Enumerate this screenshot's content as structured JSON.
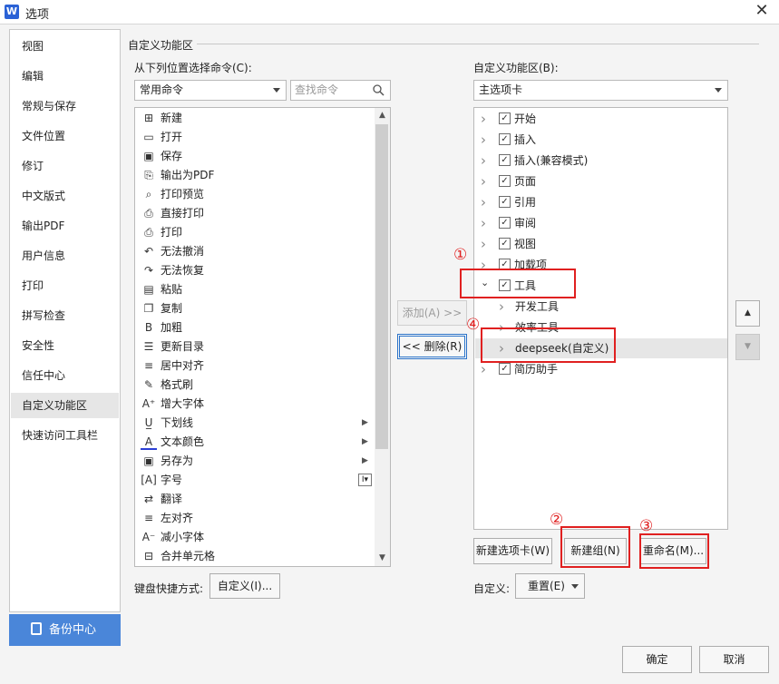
{
  "window": {
    "title": "选项",
    "app_badge": "W",
    "close_glyph": "✕"
  },
  "sidebar": {
    "items": [
      {
        "label": "视图"
      },
      {
        "label": "编辑"
      },
      {
        "label": "常规与保存"
      },
      {
        "label": "文件位置"
      },
      {
        "label": "修订"
      },
      {
        "label": "中文版式"
      },
      {
        "label": "输出PDF"
      },
      {
        "label": "用户信息"
      },
      {
        "label": "打印"
      },
      {
        "label": "拼写检查"
      },
      {
        "label": "安全性"
      },
      {
        "label": "信任中心"
      },
      {
        "label": "自定义功能区",
        "active": true
      },
      {
        "label": "快速访问工具栏"
      }
    ],
    "backup_label": "备份中心"
  },
  "main": {
    "section_title": "自定义功能区",
    "left": {
      "source_label": "从下列位置选择命令(C):",
      "source_value": "常用命令",
      "search_placeholder": "查找命令",
      "commands": [
        {
          "icon": "new-icon",
          "glyph": "⊞",
          "label": "新建"
        },
        {
          "icon": "open-icon",
          "glyph": "▭",
          "label": "打开"
        },
        {
          "icon": "save-icon",
          "glyph": "▣",
          "label": "保存"
        },
        {
          "icon": "export-pdf-icon",
          "glyph": "⎘",
          "label": "输出为PDF"
        },
        {
          "icon": "print-preview-icon",
          "glyph": "⌕",
          "label": "打印预览"
        },
        {
          "icon": "direct-print-icon",
          "glyph": "⎙",
          "label": "直接打印"
        },
        {
          "icon": "print-icon",
          "glyph": "⎙",
          "label": "打印"
        },
        {
          "icon": "undo-icon",
          "glyph": "↶",
          "label": "无法撤消"
        },
        {
          "icon": "redo-icon",
          "glyph": "↷",
          "label": "无法恢复"
        },
        {
          "icon": "paste-icon",
          "glyph": "▤",
          "label": "粘贴"
        },
        {
          "icon": "copy-icon",
          "glyph": "❐",
          "label": "复制"
        },
        {
          "icon": "bold-icon",
          "glyph": "B",
          "label": "加粗"
        },
        {
          "icon": "update-toc-icon",
          "glyph": "☰",
          "label": "更新目录"
        },
        {
          "icon": "align-center-icon",
          "glyph": "≡",
          "label": "居中对齐"
        },
        {
          "icon": "format-painter-icon",
          "glyph": "✎",
          "label": "格式刷"
        },
        {
          "icon": "grow-font-icon",
          "glyph": "A⁺",
          "label": "增大字体"
        },
        {
          "icon": "underline-icon",
          "glyph": "U̲",
          "label": "下划线",
          "sub": "▶"
        },
        {
          "icon": "font-color-icon",
          "glyph": "A",
          "label": "文本颜色",
          "sub": "▶"
        },
        {
          "icon": "save-as-icon",
          "glyph": "▣",
          "label": "另存为",
          "sub": "▶"
        },
        {
          "icon": "font-size-icon",
          "glyph": "[A]",
          "label": "字号",
          "dropdown": "I▾"
        },
        {
          "icon": "translate-icon",
          "glyph": "⇄",
          "label": "翻译"
        },
        {
          "icon": "align-left-icon",
          "glyph": "≡",
          "label": "左对齐"
        },
        {
          "icon": "shrink-font-icon",
          "glyph": "A⁻",
          "label": "减小字体"
        },
        {
          "icon": "merge-cells-icon",
          "glyph": "⊟",
          "label": "合并单元格"
        }
      ],
      "shortcut_label": "键盘快捷方式:",
      "shortcut_button": "自定义(I)..."
    },
    "middle": {
      "add_button": "添加(A) >>",
      "remove_button": "<< 删除(R)"
    },
    "right": {
      "target_label": "自定义功能区(B):",
      "target_value": "主选项卡",
      "tree": [
        {
          "label": "开始",
          "checked": true,
          "expanded": false,
          "level": 0
        },
        {
          "label": "插入",
          "checked": true,
          "expanded": false,
          "level": 0
        },
        {
          "label": "插入(兼容模式)",
          "checked": true,
          "expanded": false,
          "level": 0
        },
        {
          "label": "页面",
          "checked": true,
          "expanded": false,
          "level": 0
        },
        {
          "label": "引用",
          "checked": true,
          "expanded": false,
          "level": 0
        },
        {
          "label": "审阅",
          "checked": true,
          "expanded": false,
          "level": 0
        },
        {
          "label": "视图",
          "checked": true,
          "expanded": false,
          "level": 0
        },
        {
          "label": "加载项",
          "checked": true,
          "expanded": false,
          "level": 0
        },
        {
          "label": "工具",
          "checked": true,
          "expanded": true,
          "level": 0
        },
        {
          "label": "开发工具",
          "level": 1
        },
        {
          "label": "效率工具",
          "level": 1
        },
        {
          "label": "deepseek(自定义)",
          "level": 1,
          "selected": true
        },
        {
          "label": "简历助手",
          "checked": true,
          "expanded": false,
          "level": 0
        }
      ],
      "new_tab_button": "新建选项卡(W)",
      "new_group_button": "新建组(N)",
      "rename_button": "重命名(M)...",
      "customize_label": "自定义:",
      "reset_button": "重置(E)",
      "move_up_glyph": "▲",
      "move_down_glyph": "▼"
    },
    "annotations": [
      "①",
      "②",
      "③",
      "④"
    ]
  },
  "footer": {
    "ok_button": "确定",
    "cancel_button": "取消"
  },
  "colors": {
    "accent": "#4a86d9",
    "annotation": "#e02020"
  }
}
